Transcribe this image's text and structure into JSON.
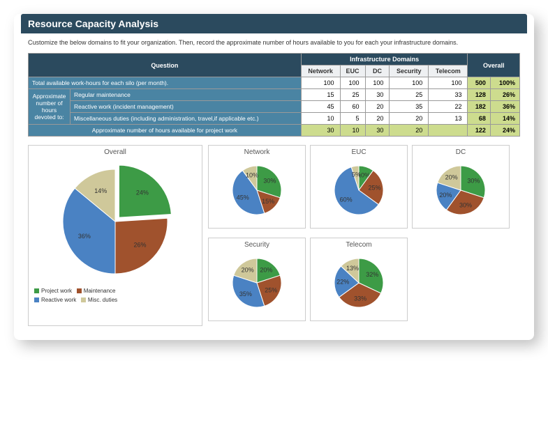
{
  "title": "Resource Capacity Analysis",
  "instruction": "Customize the below domains to fit your organization. Then, record the approximate number of hours available to you for each your infrastructure domains.",
  "table": {
    "question_header": "Question",
    "domains_header": "Infrastructure Domains",
    "overall_header": "Overall",
    "columns": [
      "Network",
      "EUC",
      "DC",
      "Security",
      "Telecom"
    ],
    "side_label": "Approximate number of hours devoted to:",
    "rows": [
      {
        "label": "Total available work-hours for each silo (per month).",
        "vals": [
          100,
          100,
          100,
          100,
          100
        ],
        "overall": 500,
        "pct": "100%"
      },
      {
        "label": "Regular maintenance",
        "vals": [
          15,
          25,
          30,
          25,
          33
        ],
        "overall": 128,
        "pct": "26%"
      },
      {
        "label": "Reactive work (incident management)",
        "vals": [
          45,
          60,
          20,
          35,
          22
        ],
        "overall": 182,
        "pct": "36%"
      },
      {
        "label": "Miscellaneous duties (including administration, travel,if applicable etc.)",
        "vals": [
          10,
          5,
          20,
          20,
          13
        ],
        "overall": 68,
        "pct": "14%"
      },
      {
        "label": "Approximate number of hours available for project work",
        "vals": [
          30,
          10,
          30,
          20,
          ""
        ],
        "overall": 122,
        "pct": "24%"
      }
    ]
  },
  "legend": {
    "project": "Project work",
    "maintenance": "Maintenance",
    "reactive": "Reactive work",
    "misc": "Misc. duties"
  },
  "colors": {
    "project": "#3d9b46",
    "maintenance": "#a0522d",
    "reactive": "#4a82c3",
    "misc": "#cfc89a"
  },
  "chart_data": [
    {
      "type": "pie",
      "title": "Overall",
      "series": [
        {
          "name": "Project work",
          "value": 24
        },
        {
          "name": "Maintenance",
          "value": 26
        },
        {
          "name": "Reactive work",
          "value": 36
        },
        {
          "name": "Misc. duties",
          "value": 14
        }
      ]
    },
    {
      "type": "pie",
      "title": "Network",
      "series": [
        {
          "name": "Project work",
          "value": 30
        },
        {
          "name": "Maintenance",
          "value": 15
        },
        {
          "name": "Reactive work",
          "value": 45
        },
        {
          "name": "Misc. duties",
          "value": 10
        }
      ]
    },
    {
      "type": "pie",
      "title": "EUC",
      "series": [
        {
          "name": "Project work",
          "value": 10
        },
        {
          "name": "Maintenance",
          "value": 25
        },
        {
          "name": "Reactive work",
          "value": 60
        },
        {
          "name": "Misc. duties",
          "value": 5
        }
      ]
    },
    {
      "type": "pie",
      "title": "DC",
      "series": [
        {
          "name": "Project work",
          "value": 30
        },
        {
          "name": "Maintenance",
          "value": 30
        },
        {
          "name": "Reactive work",
          "value": 20
        },
        {
          "name": "Misc. duties",
          "value": 20
        }
      ]
    },
    {
      "type": "pie",
      "title": "Security",
      "series": [
        {
          "name": "Project work",
          "value": 20
        },
        {
          "name": "Maintenance",
          "value": 25
        },
        {
          "name": "Reactive work",
          "value": 35
        },
        {
          "name": "Misc. duties",
          "value": 20
        }
      ]
    },
    {
      "type": "pie",
      "title": "Telecom",
      "series": [
        {
          "name": "Project work",
          "value": 32
        },
        {
          "name": "Maintenance",
          "value": 33
        },
        {
          "name": "Reactive work",
          "value": 22
        },
        {
          "name": "Misc. duties",
          "value": 13
        }
      ]
    }
  ]
}
